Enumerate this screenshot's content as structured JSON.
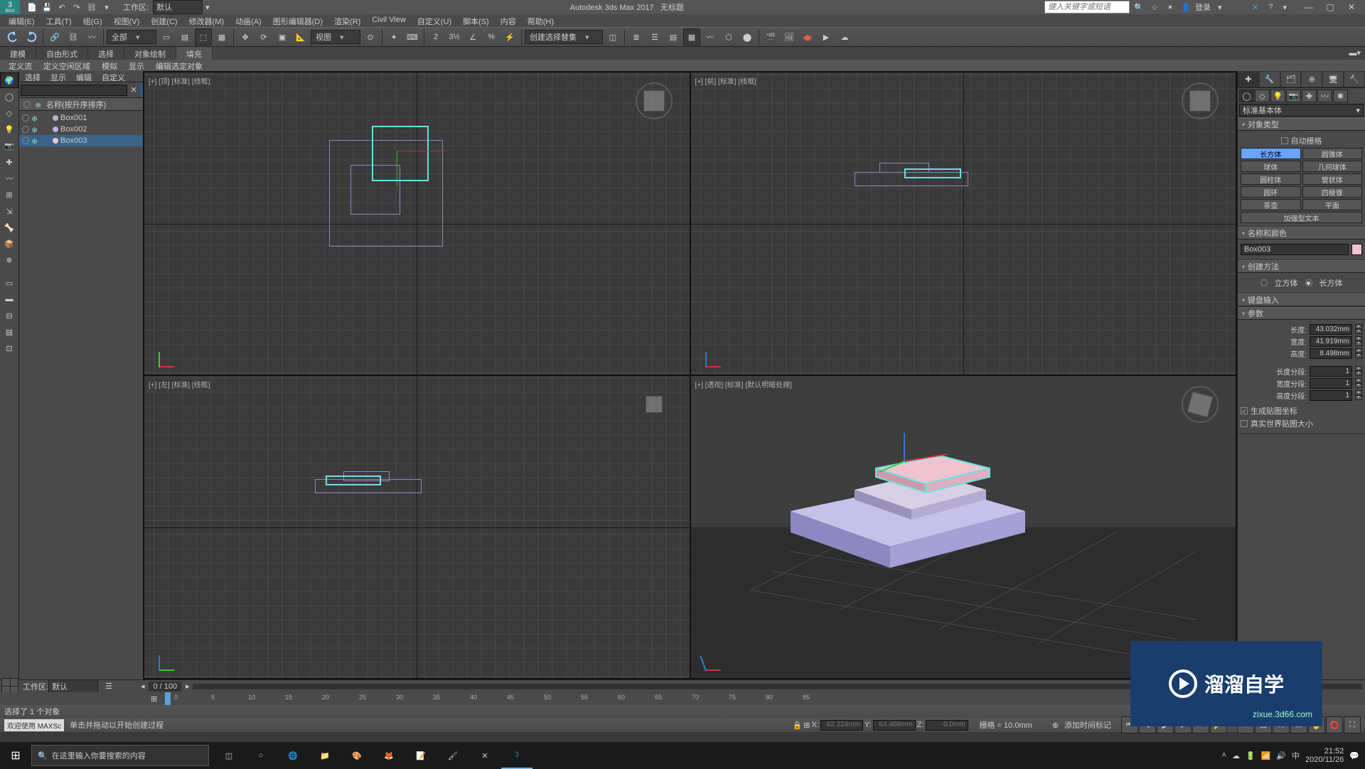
{
  "title": {
    "app": "Autodesk 3ds Max 2017",
    "doc": "无标题",
    "workspace_label": "工作区:",
    "workspace_value": "默认",
    "search_placeholder": "健入关键字或短语",
    "login": "登录"
  },
  "menu": {
    "items": [
      "编辑(E)",
      "工具(T)",
      "组(G)",
      "视图(V)",
      "创建(C)",
      "修改器(M)",
      "动画(A)",
      "图形编辑器(D)",
      "渲染(R)",
      "Civil View",
      "自定义(U)",
      "脚本(S)",
      "内容",
      "帮助(H)"
    ]
  },
  "toolbar": {
    "sel_filter": "全部",
    "ref_frame": "视图",
    "named_sel": "创建选择替集"
  },
  "ribbon": {
    "tabs": [
      "建模",
      "自由形式",
      "选择",
      "对象绘制",
      "填充"
    ],
    "sub": [
      "定义流",
      "定义空闲区域",
      "模拟",
      "显示",
      "编辑选定对象"
    ]
  },
  "scene": {
    "menu": [
      "选择",
      "显示",
      "编辑",
      "自定义"
    ],
    "header": "名称(按升序排序)",
    "items": [
      {
        "name": "Box001",
        "color": "#c7a8d6"
      },
      {
        "name": "Box002",
        "color": "#b8b0e8"
      },
      {
        "name": "Box003",
        "color": "#f2c4d0"
      }
    ]
  },
  "viewports": {
    "top": "[+] [顶] [标准] [线框]",
    "front": "[+] [前] [标准] [线框]",
    "left": "[+] [左] [标准] [线框]",
    "persp": "[+] [透视] [标准] [默认明暗处理]"
  },
  "cmd": {
    "dropdown": "标准基本体",
    "rollouts": {
      "object_type": "对象类型",
      "auto_grid": "自动栅格",
      "name_color": "名称和颜色",
      "create_method": "创建方法",
      "cube": "立方体",
      "box": "长方体",
      "keyboard": "键盘输入",
      "params": "参数",
      "length": "长度:",
      "width": "宽度:",
      "height": "高度:",
      "lseg": "长度分段:",
      "wseg": "宽度分段:",
      "hseg": "高度分段:",
      "gen_uv": "生成贴图坐标",
      "real_world": "真实世界贴图大小"
    },
    "buttons": {
      "box": "长方体",
      "cone": "圆锥体",
      "sphere": "球体",
      "geo": "几何球体",
      "cyl": "圆柱体",
      "tube": "管状体",
      "torus": "圆环",
      "pyramid": "四棱锥",
      "teapot": "茶壶",
      "plane": "平面",
      "textplus": "加强型文本"
    },
    "current_name": "Box003",
    "values": {
      "length": "43.032mm",
      "width": "41.919mm",
      "height": "8.498mm",
      "lseg": "1",
      "wseg": "1",
      "hseg": "1"
    }
  },
  "timeline": {
    "current": "0 / 100",
    "ticks": [
      "0",
      "5",
      "10",
      "15",
      "20",
      "25",
      "30",
      "35",
      "40",
      "45",
      "50",
      "55",
      "60",
      "65",
      "70",
      "75",
      "80",
      "85"
    ]
  },
  "status": {
    "sel_info": "选择了 1 个对象",
    "prompt": "单击并拖动以开始创建过程",
    "welcome": "欢迎使用 MAXSc",
    "x_label": "X:",
    "x": "62.224mm",
    "y_label": "Y:",
    "y": "64.468mm",
    "z_label": "Z:",
    "z": "0.0mm",
    "grid_label": "栅格 = 10.0mm",
    "add_time": "添加时间标记"
  },
  "bottom_left": {
    "workspace_label": "工作区:",
    "workspace_value": "默认"
  },
  "taskbar": {
    "search": "在这里输入你要搜索的内容",
    "time": "21:52",
    "date": "2020/11/26"
  },
  "watermark": {
    "txt": "溜溜自学",
    "sub": "zixue.3d66.com"
  }
}
